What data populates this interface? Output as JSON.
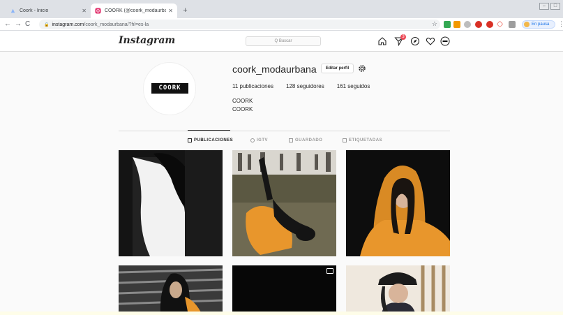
{
  "browser": {
    "tabs": [
      {
        "title": "Coork - Inicio",
        "active": false
      },
      {
        "title": "COORK (@coork_modaurbana) •",
        "active": true
      }
    ],
    "url_host": "instagram.com",
    "url_path": "/coork_modaurbana/?hl=es-la",
    "profile_status": "En pausa"
  },
  "instagram": {
    "logo": "Instagram",
    "search_placeholder": "Q Buscar",
    "notification_count": "3"
  },
  "profile": {
    "avatar_text": "COORK",
    "username": "coork_modaurbana",
    "edit_button": "Editar perfil",
    "stats": {
      "posts": "11 publicaciones",
      "followers": "128 seguidores",
      "following": "161 seguidos"
    },
    "full_name": "COORK",
    "bio": "COORK"
  },
  "tabs": [
    {
      "label": "PUBLICACIONES",
      "active": true
    },
    {
      "label": "IGTV",
      "active": false
    },
    {
      "label": "GUARDADO",
      "active": false
    },
    {
      "label": "ETIQUETADAS",
      "active": false
    }
  ],
  "posts": [
    {
      "description": "girl-white-hoodie-back"
    },
    {
      "description": "girl-orange-hoodie-couch"
    },
    {
      "description": "girl-orange-hoodie-portrait"
    },
    {
      "description": "girl-stairs"
    },
    {
      "description": "dark-video"
    },
    {
      "description": "girl-black-cap"
    }
  ],
  "colors": {
    "accent_orange": "#e8962c",
    "badge_red": "#ed4956",
    "text": "#262626",
    "muted": "#8e8e8e"
  }
}
